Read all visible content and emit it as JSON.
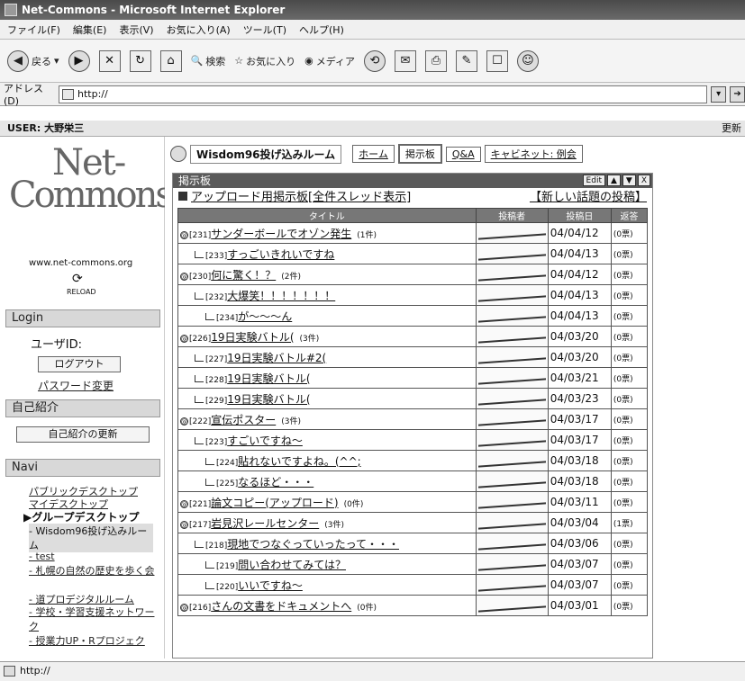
{
  "window": {
    "title": "Net-Commons - Microsoft Internet Explorer"
  },
  "menu": [
    "ファイル(F)",
    "編集(E)",
    "表示(V)",
    "お気に入り(A)",
    "ツール(T)",
    "ヘルプ(H)"
  ],
  "toolbar": {
    "back": "戻る",
    "search": "検索",
    "favorites": "お気に入り",
    "media": "メディア"
  },
  "address": {
    "label": "アドレス(D)",
    "value": "http://"
  },
  "userbar": {
    "user": "USER: 大野栄三",
    "right": "更新"
  },
  "sidebar": {
    "site": "www.net-commons.org",
    "reload": "RELOAD",
    "login_head": "Login",
    "userid_label": "ユーザID:",
    "logout_button": "ログアウト",
    "password_link": "パスワード変更",
    "profile_head": "自己紹介",
    "profile_button": "自己紹介の更新",
    "navi_head": "Navi",
    "navi": [
      "パブリックデスクトップ",
      "マイデスクトップ",
      "▶グループデスクトップ",
      "- Wisdom96投げ込みルーム",
      "- test",
      "- 札幌の自然の歴史を歩く会",
      "- 道プロデジタルルーム",
      "- 学校・学習支援ネットワーク",
      "- 授業力UP・Rプロジェク"
    ]
  },
  "main": {
    "room_title": "Wisdom96投げ込みルーム",
    "tabs": [
      "ホーム",
      "掲示板",
      "Q&A",
      "キャビネット: 例会"
    ],
    "panel_title": "掲示板",
    "panel_edit": "Edit",
    "board_title": "アップロード用掲示板[全件スレッド表示]",
    "new_topic": "【新しい話題の投稿】",
    "columns": [
      "タイトル",
      "投稿者",
      "投稿日",
      "返答"
    ],
    "rows": [
      {
        "level": 0,
        "no": "[231]",
        "title": "サンダーボールでオゾン発生",
        "count": "(1件)",
        "date": "04/04/12",
        "replies": "(0票)"
      },
      {
        "level": 1,
        "no": "[233]",
        "title": "すっごいきれいですね",
        "count": "",
        "date": "04/04/13",
        "replies": "(0票)"
      },
      {
        "level": 0,
        "no": "[230]",
        "title": "何に驚く！？",
        "count": "(2件)",
        "date": "04/04/12",
        "replies": "(0票)"
      },
      {
        "level": 1,
        "no": "[232]",
        "title": "大爆笑！！！！！！！",
        "count": "",
        "date": "04/04/13",
        "replies": "(0票)"
      },
      {
        "level": 2,
        "no": "[234]",
        "title": "が～～～ん",
        "count": "",
        "date": "04/04/13",
        "replies": "(0票)"
      },
      {
        "level": 0,
        "no": "[226]",
        "title": "19日実験バトル(",
        "count": "(3件)",
        "date": "04/03/20",
        "replies": "(0票)"
      },
      {
        "level": 1,
        "no": "[227]",
        "title": "19日実験バトル#2(",
        "count": "",
        "date": "04/03/20",
        "replies": "(0票)"
      },
      {
        "level": 1,
        "no": "[228]",
        "title": "19日実験バトル(",
        "count": "",
        "date": "04/03/21",
        "replies": "(0票)"
      },
      {
        "level": 1,
        "no": "[229]",
        "title": "19日実験バトル(",
        "count": "",
        "date": "04/03/23",
        "replies": "(0票)"
      },
      {
        "level": 0,
        "no": "[222]",
        "title": "宣伝ポスター",
        "count": "(3件)",
        "date": "04/03/17",
        "replies": "(0票)"
      },
      {
        "level": 1,
        "no": "[223]",
        "title": "すごいですね～",
        "count": "",
        "date": "04/03/17",
        "replies": "(0票)"
      },
      {
        "level": 2,
        "no": "[224]",
        "title": "貼れないですよね。(^^;",
        "count": "",
        "date": "04/03/18",
        "replies": "(0票)"
      },
      {
        "level": 2,
        "no": "[225]",
        "title": "なるほど・・・",
        "count": "",
        "date": "04/03/18",
        "replies": "(0票)"
      },
      {
        "level": 0,
        "no": "[221]",
        "title": "論文コピー(アップロード)",
        "count": "(0件)",
        "date": "04/03/11",
        "replies": "(0票)"
      },
      {
        "level": 0,
        "no": "[217]",
        "title": "岩見沢レールセンター",
        "count": "(3件)",
        "date": "04/03/04",
        "replies": "(1票)"
      },
      {
        "level": 1,
        "no": "[218]",
        "title": "現地でつなぐっていったって・・・",
        "count": "",
        "date": "04/03/06",
        "replies": "(0票)"
      },
      {
        "level": 2,
        "no": "[219]",
        "title": "問い合わせてみては？",
        "count": "",
        "date": "04/03/07",
        "replies": "(0票)"
      },
      {
        "level": 2,
        "no": "[220]",
        "title": "いいですね～",
        "count": "",
        "date": "04/03/07",
        "replies": "(0票)"
      },
      {
        "level": 0,
        "no": "[216]",
        "title": "さんの文書をドキュメントへ",
        "count": "(0件)",
        "date": "04/03/01",
        "replies": "(0票)"
      }
    ]
  },
  "status": {
    "text": "http://"
  }
}
